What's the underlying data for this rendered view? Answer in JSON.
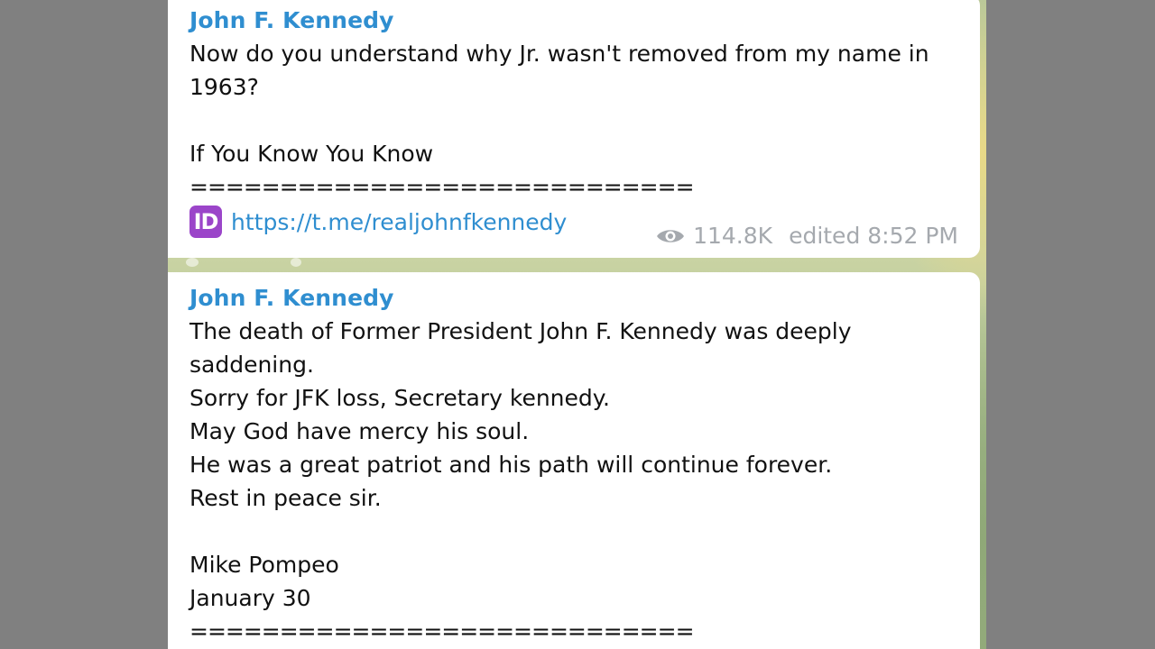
{
  "messages": [
    {
      "sender": "John F. Kennedy",
      "lines": [
        "Now do you understand why Jr. wasn't removed from my name in",
        "1963?",
        "",
        "If You Know You Know",
        "============================"
      ],
      "link_icon": "ID-emoji-icon",
      "link_text": "https://t.me/realjohnfkennedy",
      "views": "114.8K",
      "edited_time": "edited 8:52 PM"
    },
    {
      "sender": "John F. Kennedy",
      "lines": [
        "The death of Former President John F. Kennedy was deeply",
        "saddening.",
        "Sorry for JFK loss, Secretary kennedy.",
        "May God have mercy his soul.",
        "He was a great patriot and his path will continue forever.",
        "Rest in peace sir.",
        "",
        "Mike Pompeo",
        "January 30",
        "============================"
      ]
    }
  ],
  "icons": {
    "views": "eye-icon",
    "id_badge_text": "ID"
  },
  "colors": {
    "sender": "#2f8ed0",
    "link": "#2f8ed0",
    "meta": "#a5a9ae",
    "id_badge": "#9b45c9",
    "backdrop": "#808080"
  }
}
